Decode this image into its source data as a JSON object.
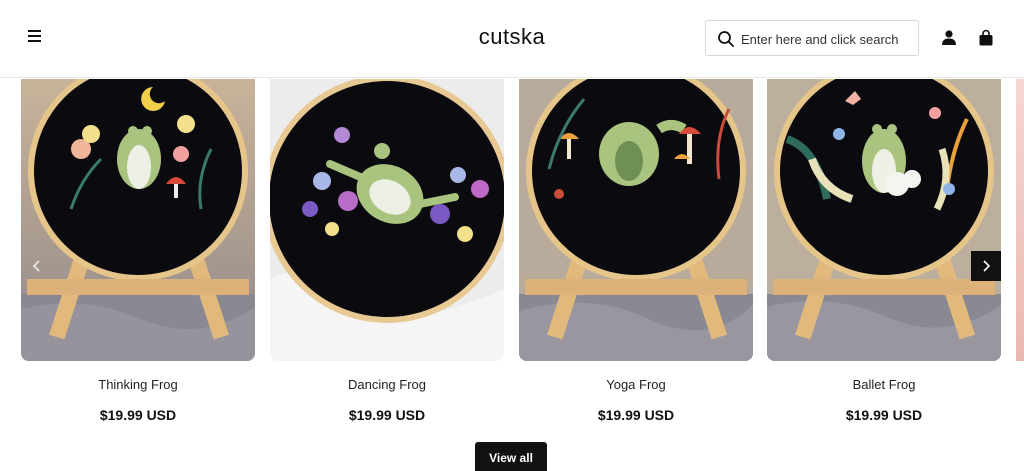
{
  "header": {
    "logo": "cutska",
    "search_placeholder": "Enter here and click search",
    "icons": [
      "menu-icon",
      "search-icon",
      "user-icon",
      "bag-icon"
    ]
  },
  "products": [
    {
      "title": "Thinking Frog",
      "price": "$19.99 USD"
    },
    {
      "title": "Dancing Frog",
      "price": "$19.99 USD"
    },
    {
      "title": "Yoga Frog",
      "price": "$19.99 USD"
    },
    {
      "title": "Ballet Frog",
      "price": "$19.99 USD"
    }
  ],
  "view_all_label": "View all",
  "colors": {
    "accent": "#111111",
    "hoop_fabric": "#0b0b0f",
    "hoop_wood": "#e6c58b",
    "frog": "#a9c47f"
  }
}
